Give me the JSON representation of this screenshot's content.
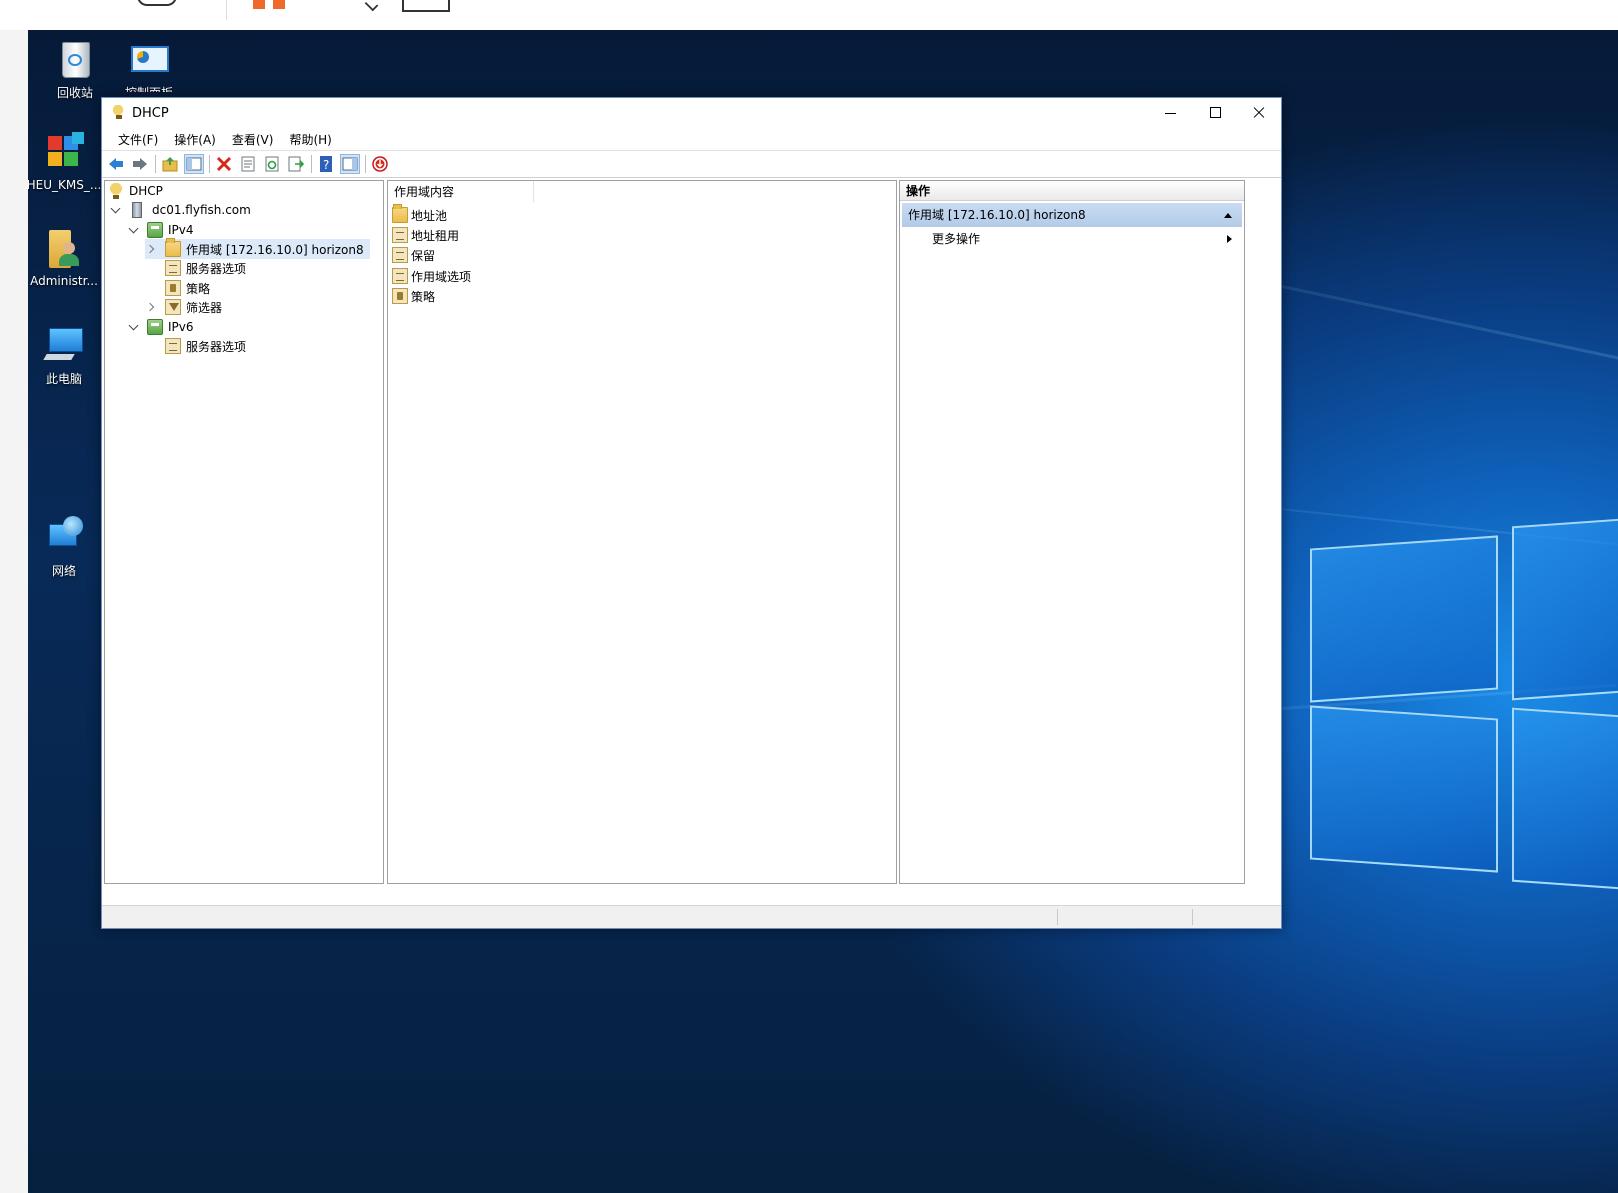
{
  "desktop": {
    "icons": [
      {
        "label": "回收站",
        "icon": "recycle-bin-icon"
      },
      {
        "label": "控制面板",
        "icon": "control-panel-icon"
      },
      {
        "label": "HEU_KMS_...",
        "icon": "heu-kms-icon"
      },
      {
        "label": "Administr...",
        "icon": "user-folder-icon"
      },
      {
        "label": "此电脑",
        "icon": "this-pc-icon"
      },
      {
        "label": "网络",
        "icon": "network-icon"
      }
    ]
  },
  "window": {
    "title": "DHCP",
    "menu": [
      "文件(F)",
      "操作(A)",
      "查看(V)",
      "帮助(H)"
    ],
    "toolbar": [
      "back-icon",
      "forward-icon",
      "up-folder-icon",
      "show-hide-tree-icon",
      "delete-icon",
      "properties-icon",
      "refresh-icon",
      "export-list-icon",
      "help-icon",
      "show-hide-action-pane-icon",
      "stop-service-icon"
    ]
  },
  "tree": {
    "root": "DHCP",
    "server": "dc01.flyfish.com",
    "ipv4": "IPv4",
    "scope": "作用域 [172.16.10.0] horizon8",
    "server_options": "服务器选项",
    "policies": "策略",
    "filters": "筛选器",
    "ipv6": "IPv6",
    "ipv6_server_options": "服务器选项"
  },
  "content": {
    "column_header": "作用域内容",
    "items": [
      "地址池",
      "地址租用",
      "保留",
      "作用域选项",
      "策略"
    ]
  },
  "actions": {
    "title": "操作",
    "section": "作用域 [172.16.10.0] horizon8",
    "more": "更多操作"
  },
  "colors": {
    "selection": "#dbe9f8",
    "action_header": "#b3cbe8",
    "wallpaper_blue": "#0e5fb8"
  }
}
